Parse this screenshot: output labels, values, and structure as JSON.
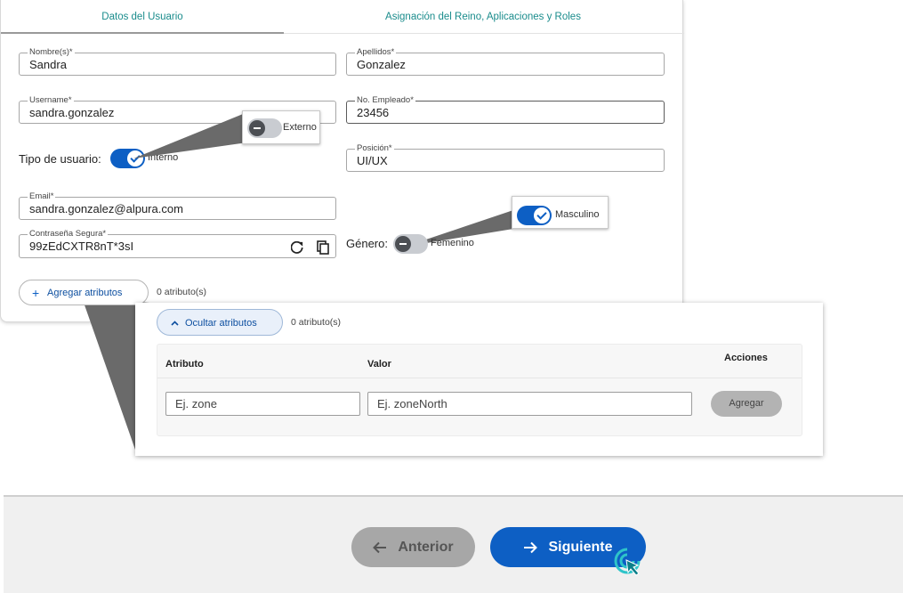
{
  "tabs": {
    "user_data": "Datos del Usuario",
    "assignment": "Asignación del Reino, Aplicaciones y Roles"
  },
  "form": {
    "first_name": {
      "label": "Nombre(s)*",
      "value": "Sandra"
    },
    "last_name": {
      "label": "Apellidos*",
      "value": "Gonzalez"
    },
    "username": {
      "label": "Username*",
      "value": "sandra.gonzalez"
    },
    "employee_no": {
      "label": "No. Empleado*",
      "value": "23456"
    },
    "position": {
      "label": "Posición*",
      "value": "UI/UX"
    },
    "email": {
      "label": "Email*",
      "value": "sandra.gonzalez@alpura.com"
    },
    "password": {
      "label": "Contraseña Segura*",
      "value": "99zEdCXTR8nT*3sI"
    },
    "user_type": {
      "label": "Tipo de usuario:",
      "on_label": "Interno",
      "off_label": "Externo",
      "checked": true
    },
    "gender": {
      "label": "Género:",
      "off_label": "Femenino",
      "on_label": "Masculino",
      "checked": false
    }
  },
  "attributes": {
    "add_label": "Agregar atributos",
    "count_text": "0 atributo(s)",
    "hide_label": "Ocultar atributos",
    "table": {
      "headers": [
        "Atributo",
        "Valor",
        "Acciones"
      ],
      "attribute_placeholder": "Ej. zone",
      "value_placeholder": "Ej. zoneNorth",
      "add_button": "Agregar"
    }
  },
  "footer": {
    "prev_label": "Anterior",
    "next_label": "Siguiente"
  },
  "colors": {
    "primary": "#0d5fc4",
    "tab_accent": "#1a8c8c",
    "disabled": "#a7a7a7"
  }
}
